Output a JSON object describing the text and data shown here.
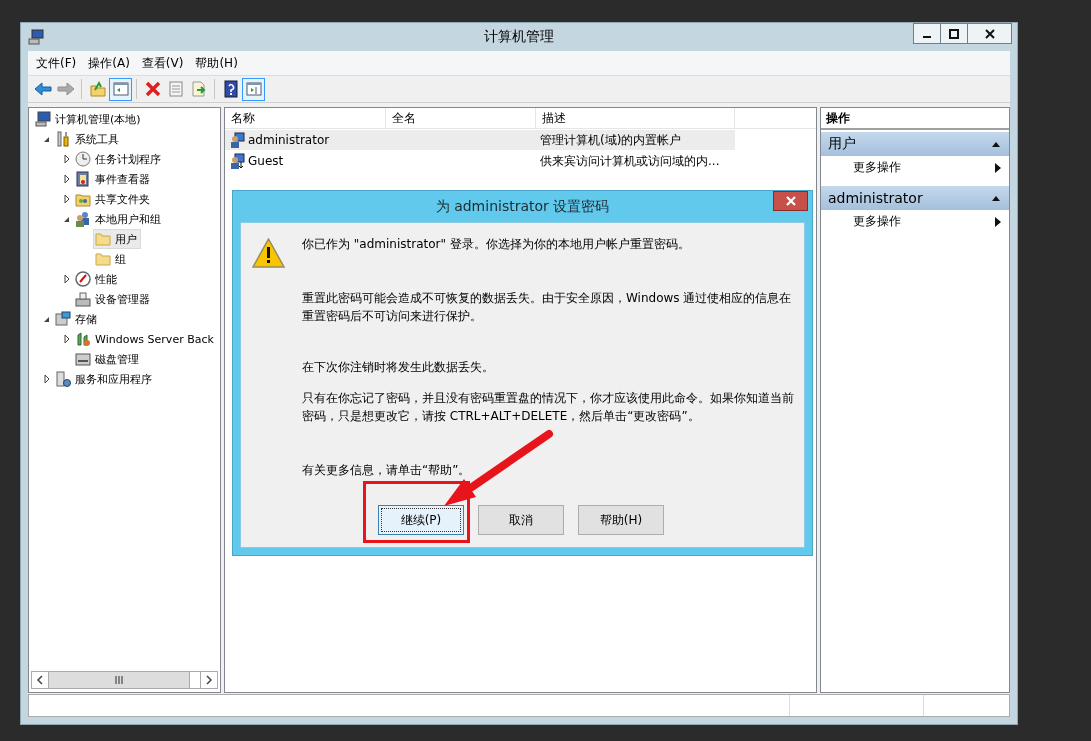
{
  "window": {
    "title": "计算机管理"
  },
  "menu": [
    "文件(F)",
    "操作(A)",
    "查看(V)",
    "帮助(H)"
  ],
  "toolbar": [
    {
      "kind": "back",
      "pressed": false,
      "disabled": false
    },
    {
      "kind": "forward",
      "pressed": false,
      "disabled": true
    },
    {
      "kind": "up",
      "pressed": false,
      "disabled": false
    },
    {
      "kind": "tree",
      "pressed": true,
      "disabled": false
    },
    {
      "kind": "delete",
      "pressed": false,
      "disabled": false
    },
    {
      "kind": "properties",
      "pressed": false,
      "disabled": false
    },
    {
      "kind": "export",
      "pressed": false,
      "disabled": false
    },
    {
      "kind": "help",
      "pressed": false,
      "disabled": false
    },
    {
      "kind": "action_pane",
      "pressed": true,
      "disabled": false
    }
  ],
  "tree": [
    {
      "label": "计算机管理(本地)",
      "selected": false,
      "children": [
        {
          "label": "系统工具",
          "selected": false,
          "expanded": true,
          "children": [
            {
              "label": "任务计划程序",
              "selected": false,
              "expanded": false
            },
            {
              "label": "事件查看器",
              "selected": false,
              "expanded": false
            },
            {
              "label": "共享文件夹",
              "selected": false,
              "expanded": false
            },
            {
              "label": "本地用户和组",
              "selected": false,
              "expanded": true,
              "children": [
                {
                  "label": "用户",
                  "selected": true
                },
                {
                  "label": "组",
                  "selected": false
                }
              ]
            },
            {
              "label": "性能",
              "selected": false,
              "expanded": false
            },
            {
              "label": "设备管理器",
              "selected": false
            }
          ]
        },
        {
          "label": "存储",
          "selected": false,
          "expanded": true,
          "children": [
            {
              "label": "Windows Server Back",
              "selected": false,
              "expanded": false
            },
            {
              "label": "磁盘管理",
              "selected": false
            }
          ]
        },
        {
          "label": "服务和应用程序",
          "selected": false,
          "expanded": false
        }
      ]
    }
  ],
  "list": {
    "columns": [
      "名称",
      "全名",
      "描述"
    ],
    "rows": [
      {
        "name": "administrator",
        "description": "管理计算机(域)的内置帐户",
        "selected": true
      },
      {
        "name": "Guest",
        "description": "供来宾访问计算机或访问域的内...",
        "selected": false
      }
    ]
  },
  "actions": {
    "title": "操作",
    "groups": [
      {
        "title": "用户",
        "expanded": true,
        "items": [
          "更多操作"
        ]
      },
      {
        "title": "administrator",
        "expanded": true,
        "items": [
          "更多操作"
        ]
      }
    ]
  },
  "dialog": {
    "title": "为 administrator 设置密码",
    "paragraphs": [
      "你已作为 \"administrator\" 登录。你选择为你的本地用户帐户重置密码。",
      "重置此密码可能会造成不可恢复的数据丢失。由于安全原因，Windows 通过使相应的信息在重置密码后不可访问来进行保护。",
      "在下次你注销时将发生此数据丢失。",
      "只有在你忘记了密码，并且没有密码重置盘的情况下，你才应该使用此命令。如果你知道当前密码，只是想更改它，请按 CTRL+ALT+DELETE，然后单击“更改密码”。",
      "有关更多信息，请单击“帮助”。"
    ],
    "buttons": [
      {
        "label": "继续(P)",
        "default": true
      },
      {
        "label": "取消",
        "default": false
      },
      {
        "label": "帮助(H)",
        "default": false
      }
    ]
  }
}
